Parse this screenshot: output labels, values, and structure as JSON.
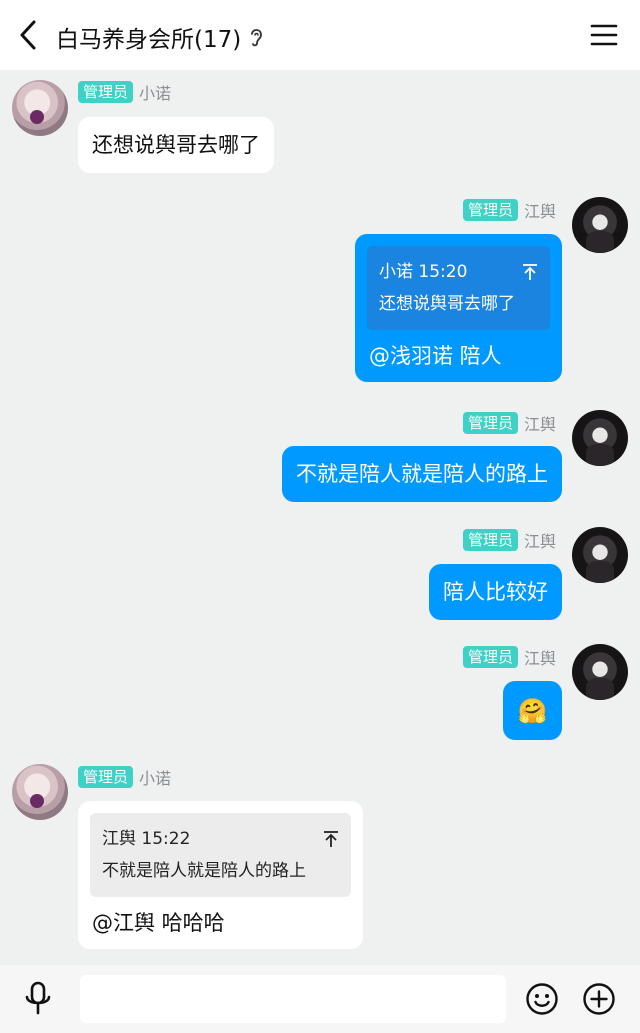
{
  "header": {
    "title": "白马养身会所(17)",
    "back_icon": "chevron-left-icon",
    "ear_icon": "ear-icon",
    "menu_icon": "hamburger-menu-icon"
  },
  "messages": [
    {
      "side": "left",
      "badge": "管理员",
      "name": "小诺",
      "text": "还想说舆哥去哪了"
    },
    {
      "side": "right",
      "badge": "管理员",
      "name": "江舆",
      "quote": {
        "author_time": "小诺 15:20",
        "text": "还想说舆哥去哪了"
      },
      "text": "@浅羽诺 陪人"
    },
    {
      "side": "right",
      "badge": "管理员",
      "name": "江舆",
      "text": "不就是陪人就是陪人的路上"
    },
    {
      "side": "right",
      "badge": "管理员",
      "name": "江舆",
      "text": "陪人比较好"
    },
    {
      "side": "right",
      "badge": "管理员",
      "name": "江舆",
      "emoji": "🤗"
    },
    {
      "side": "left",
      "badge": "管理员",
      "name": "小诺",
      "quote": {
        "author_time": "江舆 15:22",
        "text": "不就是陪人就是陪人的路上"
      },
      "text": "@江舆 哈哈哈"
    }
  ],
  "footer": {
    "input_value": "",
    "mic_icon": "microphone-icon",
    "emoji_icon": "smiley-icon",
    "plus_icon": "plus-circle-icon"
  },
  "colors": {
    "accent_blue": "#0099ff",
    "badge_teal": "#3fd1c6",
    "background": "#eef1f0"
  }
}
